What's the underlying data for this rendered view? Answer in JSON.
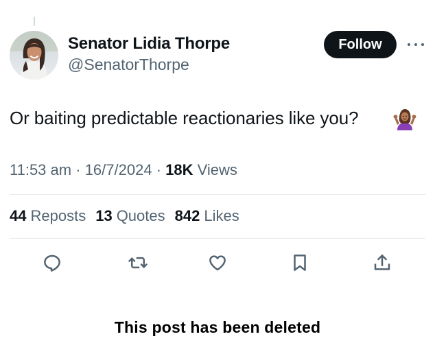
{
  "author": {
    "display_name": "Senator Lidia Thorpe",
    "handle": "@SenatorThorpe"
  },
  "follow_label": "Follow",
  "tweet": {
    "text": "Or baiting predictable reactionaries like you?",
    "emoji": "person-shrugging-emoji"
  },
  "meta": {
    "time": "11:53 am",
    "separator": "·",
    "date": "16/7/2024",
    "views_count": "18K",
    "views_label": "Views"
  },
  "stats": {
    "reposts_count": "44",
    "reposts_label": "Reposts",
    "quotes_count": "13",
    "quotes_label": "Quotes",
    "likes_count": "842",
    "likes_label": "Likes"
  },
  "actions": {
    "reply": "reply-icon",
    "repost": "repost-icon",
    "like": "heart-icon",
    "bookmark": "bookmark-icon",
    "share": "share-icon"
  },
  "footer_note": "This post has been deleted",
  "colors": {
    "text_primary": "#0f1419",
    "text_secondary": "#536471",
    "button_bg": "#0f1419",
    "divider": "#e6ebee"
  }
}
